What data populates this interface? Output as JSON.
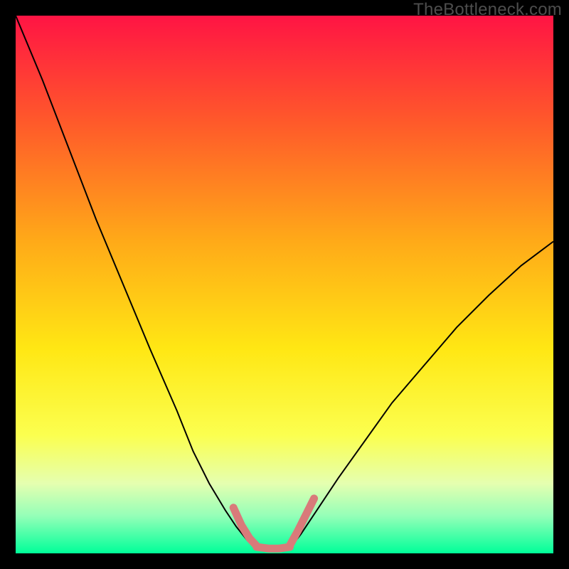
{
  "watermark": "TheBottleneck.com",
  "chart_data": {
    "type": "line",
    "title": "",
    "xlabel": "",
    "ylabel": "",
    "xlim": [
      0,
      100
    ],
    "ylim": [
      0,
      100
    ],
    "background_gradient_stops": [
      {
        "pos": 0.0,
        "color": "#ff1444"
      },
      {
        "pos": 0.2,
        "color": "#ff5a2a"
      },
      {
        "pos": 0.42,
        "color": "#ffaa18"
      },
      {
        "pos": 0.62,
        "color": "#ffe714"
      },
      {
        "pos": 0.78,
        "color": "#fbff4f"
      },
      {
        "pos": 0.87,
        "color": "#e5ffb0"
      },
      {
        "pos": 0.93,
        "color": "#95ffb8"
      },
      {
        "pos": 1.0,
        "color": "#00ff99"
      }
    ],
    "series": [
      {
        "name": "left-curve",
        "color": "#000000",
        "width": 2,
        "x": [
          0,
          5,
          10,
          15,
          20,
          25,
          30,
          33,
          36,
          39,
          41,
          43,
          44.5
        ],
        "y": [
          100,
          88,
          75,
          62,
          50,
          38,
          26.5,
          19,
          13,
          8,
          5,
          2.5,
          1
        ]
      },
      {
        "name": "right-curve",
        "color": "#000000",
        "width": 2,
        "x": [
          51,
          53,
          56,
          60,
          65,
          70,
          76,
          82,
          88,
          94,
          100
        ],
        "y": [
          1,
          3.5,
          8,
          14,
          21,
          28,
          35,
          42,
          48,
          53.5,
          58
        ]
      },
      {
        "name": "highlight-left",
        "color": "#d97a7a",
        "width": 11,
        "linecap": "round",
        "x": [
          40.5,
          42,
          43.5,
          44.8
        ],
        "y": [
          8.5,
          5.2,
          2.8,
          1.4
        ]
      },
      {
        "name": "highlight-bottom",
        "color": "#d97a7a",
        "width": 11,
        "linecap": "round",
        "x": [
          44.8,
          47,
          49,
          51
        ],
        "y": [
          1.2,
          0.9,
          0.9,
          1.2
        ]
      },
      {
        "name": "highlight-right",
        "color": "#d97a7a",
        "width": 11,
        "linecap": "round",
        "x": [
          51,
          52.5,
          54,
          55.5
        ],
        "y": [
          1.5,
          4.2,
          7.2,
          10.2
        ]
      }
    ]
  }
}
